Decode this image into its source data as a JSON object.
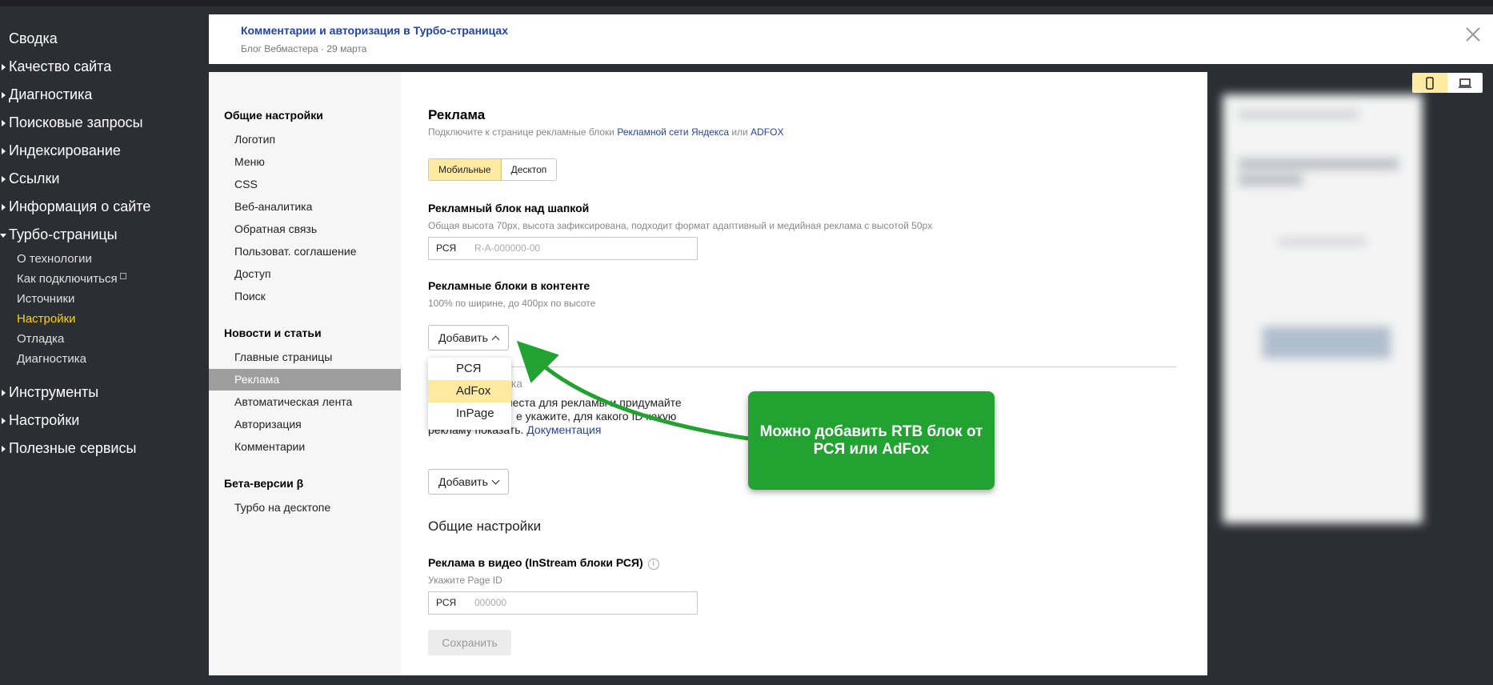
{
  "leftnav": {
    "items": [
      {
        "label": "Сводка"
      },
      {
        "label": "Качество сайта"
      },
      {
        "label": "Диагностика"
      },
      {
        "label": "Поисковые запросы"
      },
      {
        "label": "Индексирование"
      },
      {
        "label": "Ссылки"
      },
      {
        "label": "Информация о сайте"
      },
      {
        "label": "Турбо-страницы"
      }
    ],
    "subitems": [
      {
        "label": "О технологии"
      },
      {
        "label": "Как подключиться"
      },
      {
        "label": "Источники"
      },
      {
        "label": "Настройки"
      },
      {
        "label": "Отладка"
      },
      {
        "label": "Диагностика"
      }
    ],
    "bottom_items": [
      {
        "label": "Инструменты"
      },
      {
        "label": "Настройки"
      },
      {
        "label": "Полезные сервисы"
      }
    ]
  },
  "header": {
    "title": "Комментарии и авторизация в Турбо-страницах",
    "meta": "Блог Вебмастера · 29 марта"
  },
  "settings_nav": {
    "group1": "Общие настройки",
    "group1_items": [
      "Логотип",
      "Меню",
      "CSS",
      "Веб-аналитика",
      "Обратная связь",
      "Пользоват. соглашение",
      "Доступ",
      "Поиск"
    ],
    "group2": "Новости и статьи",
    "group2_items": [
      "Главные страницы",
      "Реклама",
      "Автоматическая лента",
      "Авторизация",
      "Комментарии"
    ],
    "group3": "Бета-версии β",
    "group3_items": [
      "Турбо на десктопе"
    ]
  },
  "ads": {
    "title": "Реклама",
    "subtitle_prefix": "Подключите к странице рекламные блоки",
    "link_rsya": "Рекламной сети Яндекса",
    "or": "или",
    "link_adfox": "ADFOX",
    "tab_mobile": "Мобильные",
    "tab_desktop": "Десктоп",
    "header_block_title": "Рекламный блок над шапкой",
    "header_block_hint": "Общая высота 70px, высота зафиксирована, подходит формат адаптивный и медийная реклама с высотой 50px",
    "input_label": "РСЯ",
    "input_placeholder": "R-A-000000-00",
    "content_blocks_title": "Рекламные блоки в контенте",
    "content_blocks_hint": "100% по ширине, до 400px по высоте",
    "add_label": "Добавить",
    "dropdown": [
      "РСЯ",
      "AdFox",
      "InPage"
    ],
    "hidden_text_1": "йка",
    "hidden_text_2": "места для рекламы и придумайте",
    "hidden_text_3": "е укажите, для какого ID какую",
    "hidden_text_4": "рекламу показать.",
    "doc_link": "Документация",
    "add_label_2": "Добавить",
    "general_title": "Общие настройки",
    "video_title": "Реклама в видео (InStream блоки РСЯ)",
    "video_hint": "Укажите Page ID",
    "video_input_label": "РСЯ",
    "video_input_placeholder": "000000",
    "save_label": "Сохранить"
  },
  "callout": {
    "text": "Можно добавить RTB блок от РСЯ или AdFox"
  },
  "colors": {
    "accent_green": "#22a230",
    "highlight_yellow": "#fde9a0",
    "link_blue": "#2243a8",
    "active_nav": "#ffd400"
  }
}
